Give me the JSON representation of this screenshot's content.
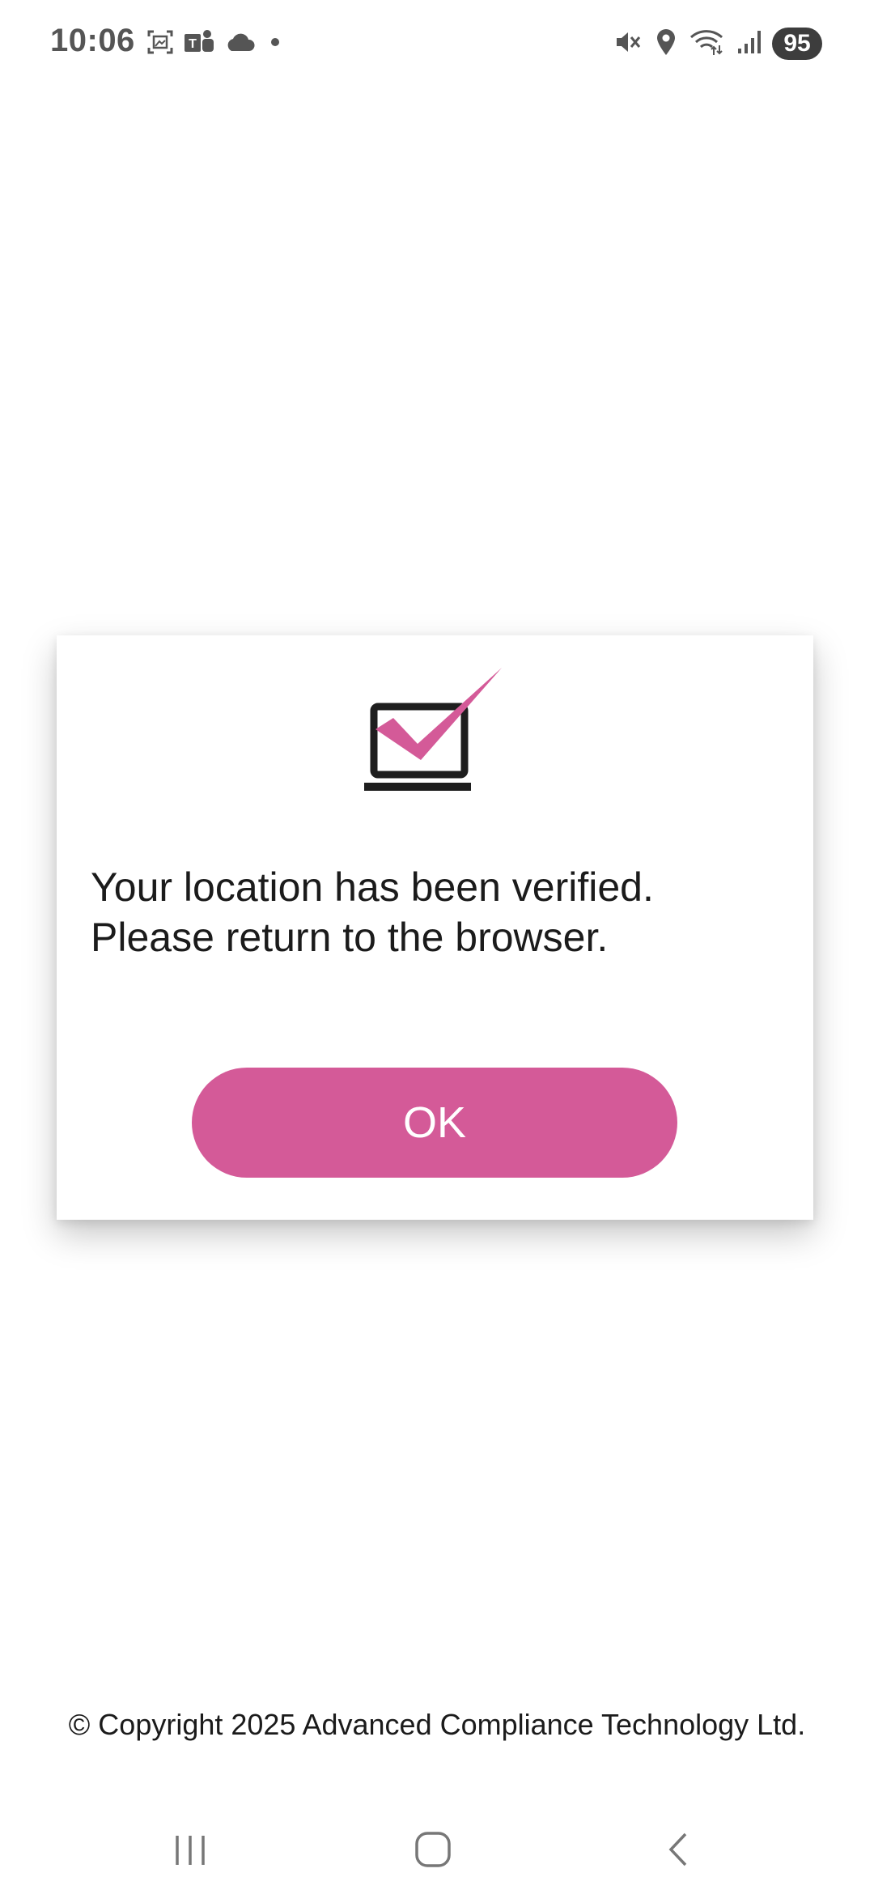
{
  "status_bar": {
    "time": "10:06",
    "battery_level": "95",
    "left_icons": [
      "screenshot-icon",
      "teams-icon",
      "cloud-icon",
      "dot-icon"
    ],
    "right_icons": [
      "mute-icon",
      "location-icon",
      "wifi-icon",
      "signal-icon"
    ]
  },
  "dialog": {
    "icon": "laptop-check-icon",
    "message_line1": "Your location has been verified.",
    "message_line2": "Please return to the browser.",
    "ok_label": "OK"
  },
  "footer": {
    "copyright": "© Copyright 2025 Advanced Compliance Technology Ltd."
  },
  "nav_bar": {
    "icons": [
      "recent-apps-icon",
      "home-icon",
      "back-icon"
    ]
  },
  "colors": {
    "accent": "#d45a98",
    "text": "#1b1b1b",
    "status_text": "#555555"
  }
}
